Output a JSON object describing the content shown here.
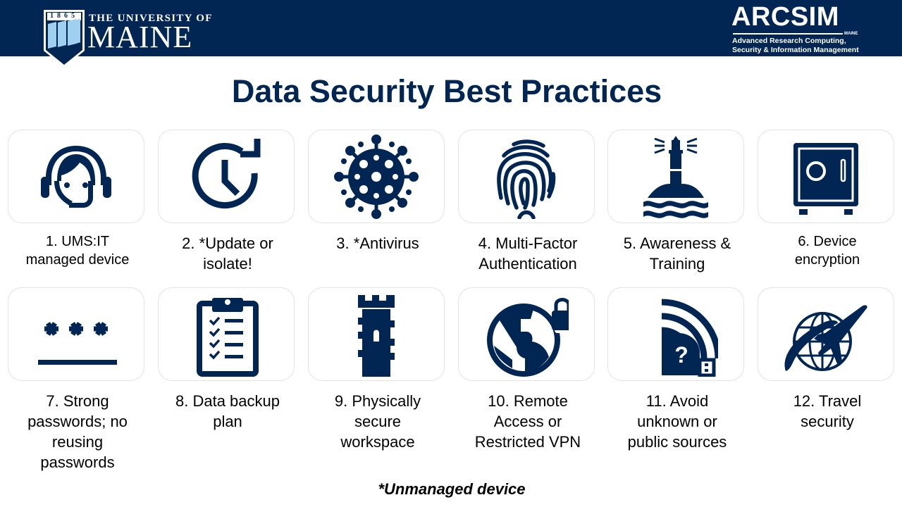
{
  "header": {
    "university_logo": {
      "year": "1865",
      "line1": "THE UNIVERSITY OF",
      "line2": "MAINE"
    },
    "arcsim_logo": {
      "title": "ARCSIM",
      "tag": "MAINE",
      "subtitle_line1": "Advanced Research Computing,",
      "subtitle_line2": "Security & Information Management"
    }
  },
  "title": "Data Security Best Practices",
  "brand_color": "#012653",
  "practices": [
    {
      "icon": "headset-support-icon",
      "line1": "1. UMS:IT",
      "line2": "managed device",
      "line3": "",
      "line4": ""
    },
    {
      "icon": "clock-refresh-icon",
      "line1": "2. *Update or",
      "line2": "isolate!",
      "line3": "",
      "line4": ""
    },
    {
      "icon": "virus-icon",
      "line1": "3. *Antivirus",
      "line2": "",
      "line3": "",
      "line4": ""
    },
    {
      "icon": "fingerprint-icon",
      "line1": "4. Multi-Factor",
      "line2": "Authentication",
      "line3": "",
      "line4": ""
    },
    {
      "icon": "lighthouse-icon",
      "line1": "5. Awareness &",
      "line2": "Training",
      "line3": "",
      "line4": ""
    },
    {
      "icon": "safe-icon",
      "line1": "6. Device",
      "line2": "encryption",
      "line3": "",
      "line4": ""
    },
    {
      "icon": "password-asterisks-icon",
      "line1": "7. Strong",
      "line2": "passwords; no",
      "line3": "reusing",
      "line4": "passwords"
    },
    {
      "icon": "clipboard-checklist-icon",
      "line1": "8. Data backup",
      "line2": "plan",
      "line3": "",
      "line4": ""
    },
    {
      "icon": "tower-icon",
      "line1": "9. Physically",
      "line2": "secure",
      "line3": "workspace",
      "line4": ""
    },
    {
      "icon": "globe-lock-icon",
      "line1": "10. Remote",
      "line2": "Access or",
      "line3": "Restricted VPN",
      "line4": ""
    },
    {
      "icon": "usb-wireless-question-icon",
      "line1": "11. Avoid",
      "line2": "unknown or",
      "line3": "public sources",
      "line4": ""
    },
    {
      "icon": "globe-airplane-icon",
      "line1": "12. Travel",
      "line2": "security",
      "line3": "",
      "line4": ""
    }
  ],
  "footnote": "*Unmanaged device"
}
